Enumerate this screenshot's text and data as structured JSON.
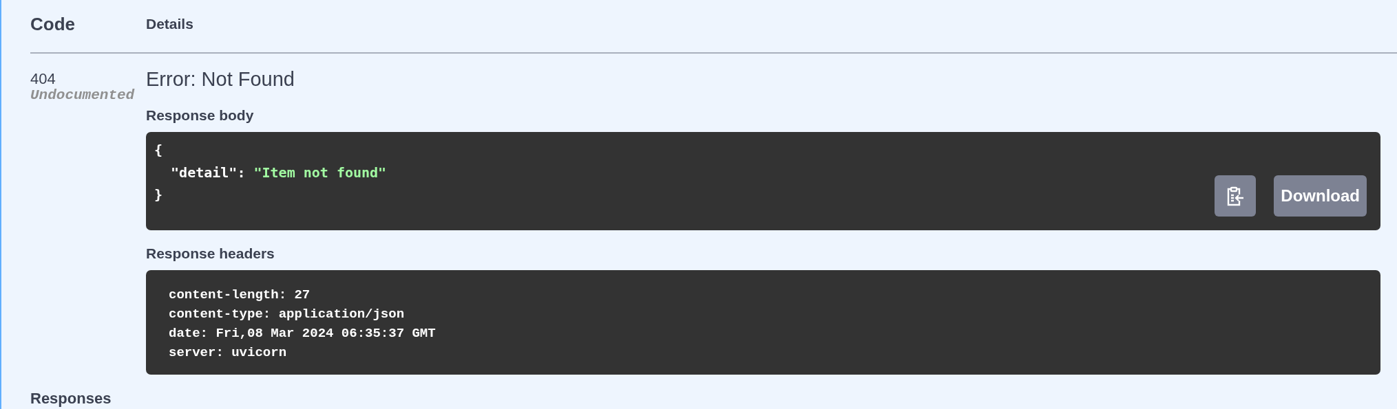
{
  "table": {
    "columns": [
      "Code",
      "Details"
    ],
    "rows": [
      {
        "code": "404",
        "note": "Undocumented",
        "title": "Error: Not Found",
        "response_body": {
          "label": "Response body",
          "lines": [
            [
              {
                "kind": "plain",
                "text": "{"
              }
            ],
            [
              {
                "kind": "plain",
                "text": "  \"detail\": "
              },
              {
                "kind": "string",
                "text": "\"Item not found\""
              }
            ],
            [
              {
                "kind": "plain",
                "text": "}"
              }
            ]
          ],
          "buttons": [
            {
              "kind": "copy"
            },
            {
              "kind": "text",
              "label": "Download"
            }
          ]
        },
        "response_headers": {
          "label": "Response headers",
          "lines": [
            "content-length: 27",
            "content-type: application/json",
            "date: Fri,08 Mar 2024 06:35:37 GMT",
            "server: uvicorn"
          ]
        }
      }
    ]
  },
  "footer": {
    "heading": "Responses"
  }
}
